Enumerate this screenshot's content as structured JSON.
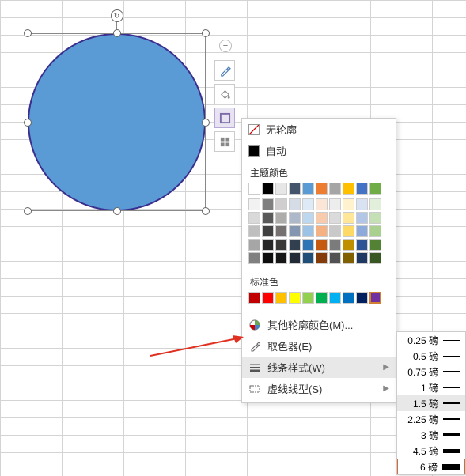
{
  "shape": {
    "type": "circle",
    "fill": "#5b9bd5",
    "outline": "#3a2f8f"
  },
  "toolbar": {
    "collapse": "−",
    "brush": "brush",
    "fill": "fill",
    "outline": "outline",
    "more": "more"
  },
  "popup": {
    "no_outline": "无轮廓",
    "auto": "自动",
    "theme_label": "主题颜色",
    "standard_label": "标准色",
    "more_colors": "其他轮廓颜色(M)...",
    "eyedropper": "取色器(E)",
    "line_style": "线条样式(W)",
    "dash_style": "虚线线型(S)",
    "theme_row0": [
      "#ffffff",
      "#000000",
      "#e7e6e6",
      "#44546a",
      "#5b9bd5",
      "#ed7d31",
      "#a5a5a5",
      "#ffc000",
      "#4472c4",
      "#70ad47"
    ],
    "theme_shades": [
      [
        "#f2f2f2",
        "#7f7f7f",
        "#d0cece",
        "#d6dce5",
        "#deebf7",
        "#fbe5d6",
        "#ededed",
        "#fff2cc",
        "#d9e2f3",
        "#e2efda"
      ],
      [
        "#d9d9d9",
        "#595959",
        "#aeabab",
        "#adb9ca",
        "#bdd7ee",
        "#f7cbac",
        "#dbdbdb",
        "#ffe699",
        "#b4c6e7",
        "#c5e0b4"
      ],
      [
        "#bfbfbf",
        "#404040",
        "#757171",
        "#8496b0",
        "#9cc3e6",
        "#f4b183",
        "#c9c9c9",
        "#ffd966",
        "#8eaadb",
        "#a9d08e"
      ],
      [
        "#a6a6a6",
        "#262626",
        "#3b3838",
        "#323f4f",
        "#2e75b6",
        "#c55a11",
        "#7b7b7b",
        "#bf8f00",
        "#2f5496",
        "#548235"
      ],
      [
        "#808080",
        "#0d0d0d",
        "#171717",
        "#222a35",
        "#1f4e79",
        "#843c0b",
        "#525252",
        "#806000",
        "#1f3864",
        "#385723"
      ]
    ],
    "standard": [
      "#c00000",
      "#ff0000",
      "#ffc000",
      "#ffff00",
      "#92d050",
      "#00b050",
      "#00b0f0",
      "#0070c0",
      "#002060",
      "#7030a0"
    ]
  },
  "submenu": {
    "items": [
      {
        "label": "0.25 磅",
        "w": 0.5
      },
      {
        "label": "0.5 磅",
        "w": 1
      },
      {
        "label": "0.75 磅",
        "w": 1.2
      },
      {
        "label": "1 磅",
        "w": 1.5
      },
      {
        "label": "1.5 磅",
        "w": 2
      },
      {
        "label": "2.25 磅",
        "w": 2.8
      },
      {
        "label": "3 磅",
        "w": 3.5
      },
      {
        "label": "4.5 磅",
        "w": 5
      },
      {
        "label": "6 磅",
        "w": 7
      }
    ],
    "highlighted": 4,
    "selected": 8
  }
}
